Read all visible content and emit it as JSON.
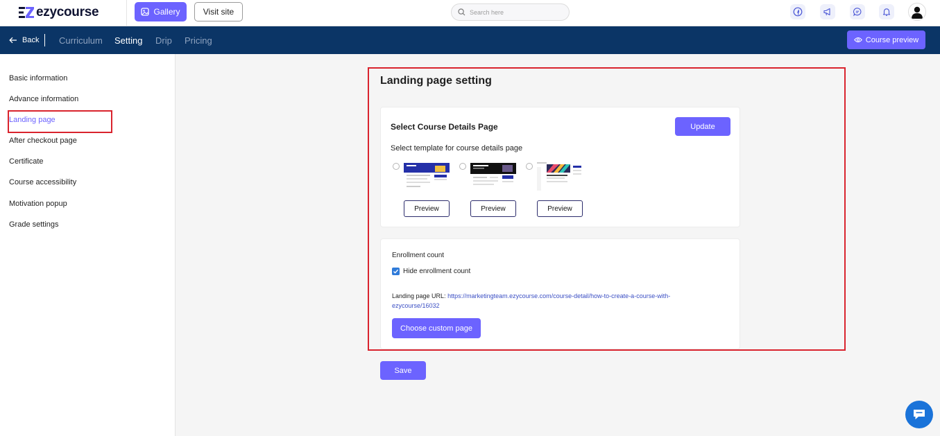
{
  "brand": {
    "name": "ezycourse",
    "accent": "#6c63ff",
    "nav_bg": "#0b3566",
    "highlight": "#d9232d"
  },
  "topbar": {
    "gallery_label": "Gallery",
    "visit_label": "Visit site",
    "search_placeholder": "Search here",
    "icons": [
      "facebook-icon",
      "megaphone-icon",
      "messenger-icon",
      "bell-icon",
      "user-avatar"
    ]
  },
  "navbar": {
    "back_label": "Back",
    "tabs": [
      {
        "label": "Curriculum",
        "active": false
      },
      {
        "label": "Setting",
        "active": true
      },
      {
        "label": "Drip",
        "active": false
      },
      {
        "label": "Pricing",
        "active": false
      }
    ],
    "course_preview_label": "Course preview"
  },
  "sidebar": {
    "items": [
      {
        "label": "Basic information",
        "active": false
      },
      {
        "label": "Advance information",
        "active": false
      },
      {
        "label": "Landing page",
        "active": true
      },
      {
        "label": "After checkout page",
        "active": false
      },
      {
        "label": "Certificate",
        "active": false
      },
      {
        "label": "Course accessibility",
        "active": false
      },
      {
        "label": "Motivation popup",
        "active": false
      },
      {
        "label": "Grade settings",
        "active": false
      }
    ]
  },
  "main": {
    "heading": "Landing page setting",
    "details_card": {
      "title": "Select Course Details Page",
      "update_label": "Update",
      "subtitle": "Select template for course details page",
      "templates": [
        {
          "preview_label": "Preview",
          "selected": false
        },
        {
          "preview_label": "Preview",
          "selected": false
        },
        {
          "preview_label": "Preview",
          "selected": false
        }
      ]
    },
    "enrollment_card": {
      "title": "Enrollment count",
      "checkbox_label": "Hide enrollment count",
      "checkbox_checked": true,
      "url_label": "Landing page URL:",
      "url_value": "https://marketingteam.ezycourse.com/course-detail/how-to-create-a-course-with-ezycourse/16032",
      "custom_page_label": "Choose custom page"
    },
    "save_label": "Save"
  }
}
